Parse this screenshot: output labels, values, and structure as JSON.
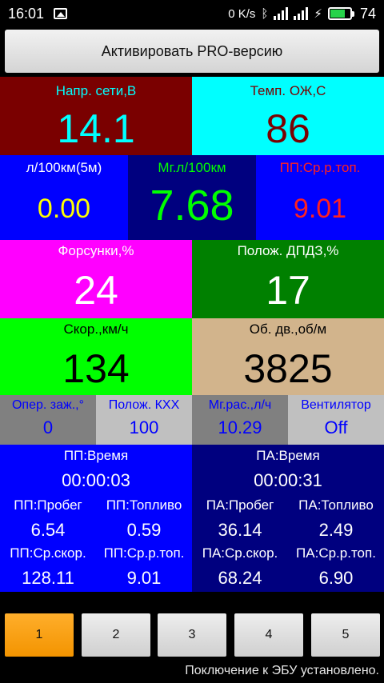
{
  "statusbar": {
    "time": "16:01",
    "net_speed": "0 K/s",
    "battery": "74",
    "battery_level": 0.74,
    "icons": [
      "image-icon",
      "bluetooth-icon",
      "signal-icon",
      "signal-icon",
      "charging-icon",
      "battery-icon"
    ]
  },
  "pro_button": "Активировать PRO-версию",
  "gauges": {
    "voltage": {
      "label": "Напр. сети,В",
      "value": "14.1"
    },
    "coolant": {
      "label": "Темп. ОЖ,С",
      "value": "86"
    },
    "consumption_5m": {
      "label": "л/100км(5м)",
      "value": "0.00"
    },
    "instant": {
      "label": "Мг.л/100км",
      "value": "7.68"
    },
    "trip_avg_fuel": {
      "label": "ПП:Ср.р.топ.",
      "value": "9.01"
    },
    "injectors": {
      "label": "Форсунки,%",
      "value": "24"
    },
    "throttle": {
      "label": "Полож. ДПДЗ,%",
      "value": "17"
    },
    "speed": {
      "label": "Скор.,км/ч",
      "value": "134"
    },
    "rpm": {
      "label": "Об. дв.,об/м",
      "value": "3825"
    },
    "ignition": {
      "label": "Опер. заж.,°",
      "value": "0"
    },
    "idle_valve": {
      "label": "Полож. КХХ",
      "value": "100"
    },
    "instant_flow": {
      "label": "Мг.рас.,л/ч",
      "value": "10.29"
    },
    "fan": {
      "label": "Вентилятор",
      "value": "Off"
    }
  },
  "trip": {
    "time": {
      "label": "ПП:Время",
      "value": "00:00:03"
    },
    "distance": {
      "label": "ПП:Пробег",
      "value": "6.54"
    },
    "fuel": {
      "label": "ПП:Топливо",
      "value": "0.59"
    },
    "avg_speed": {
      "label": "ПП:Ср.скор.",
      "value": "128.11"
    },
    "avg_fuel": {
      "label": "ПП:Ср.р.топ.",
      "value": "9.01"
    }
  },
  "total": {
    "time": {
      "label": "ПА:Время",
      "value": "00:00:31"
    },
    "distance": {
      "label": "ПА:Пробег",
      "value": "36.14"
    },
    "fuel": {
      "label": "ПА:Топливо",
      "value": "2.49"
    },
    "avg_speed": {
      "label": "ПА:Ср.скор.",
      "value": "68.24"
    },
    "avg_fuel": {
      "label": "ПА:Ср.р.топ.",
      "value": "6.90"
    }
  },
  "tabs": [
    "1",
    "2",
    "3",
    "4",
    "5"
  ],
  "active_tab": "1",
  "connection_status": "Поключение к ЭБУ установлено.",
  "colors": {
    "dark_red": "#7a0000",
    "cyan": "#00ffff",
    "blue": "#0000ff",
    "navy": "#00007f",
    "magenta": "#ff00ff",
    "green": "#008000",
    "lime": "#00ff00",
    "tan": "#d2b48c",
    "gray": "#808080",
    "light_gray": "#c0c0c0",
    "accent_orange": "#f7a21b"
  }
}
